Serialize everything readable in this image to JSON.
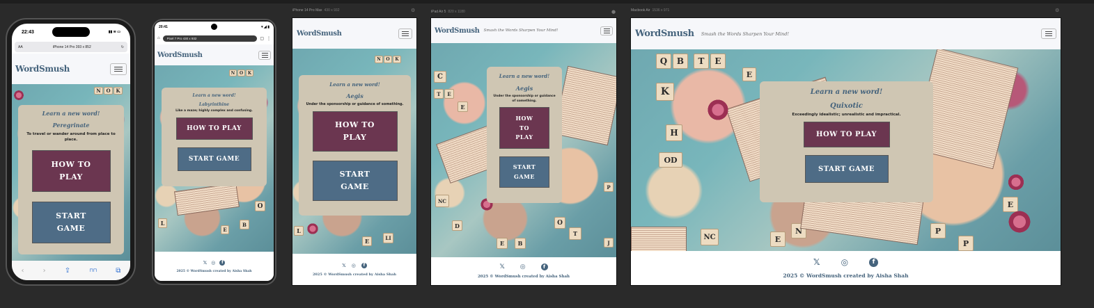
{
  "site": {
    "logo": "WordSmush",
    "tagline": "Smash the Words Sharpen Your Mind!",
    "learn_heading": "Learn a new word!",
    "how_to_play": "HOW TO PLAY",
    "start_game": "START GAME",
    "copyright": "2025 © WordSmush created by Aisha Shah",
    "social_icons": [
      "x-icon",
      "instagram-icon",
      "facebook-icon"
    ]
  },
  "frames": {
    "iphone14pro": {
      "time": "22:43",
      "status_icons": "▮▮ ≋ ▭",
      "url_aa": "AA",
      "url_label": "iPhone 14 Pro  393 x 852",
      "reload": "↻",
      "word": "Peregrinate",
      "definition": "To travel or wander around from place to place."
    },
    "pixel7pro": {
      "time": "20:41",
      "status_icons": "▾ ◢ ▮",
      "url_label": "Pixel 7 Pro  430 x 932",
      "word": "Labyrinthine",
      "definition": "Like a maze; highly complex and confusing."
    },
    "iphone14promax": {
      "label": "iPhone 14 Pro Max",
      "dims": "430 x 932",
      "word": "Aegis",
      "definition": "Under the sponsorship or guidance of something."
    },
    "ipadair": {
      "label": "iPad Air 5",
      "dims": "820 x 1180",
      "word": "Aegis",
      "definition": "Under the sponsorship or guidance of something."
    },
    "macbookair": {
      "label": "Macbook Air",
      "dims": "1536 x 971",
      "word": "Quixotic",
      "definition": "Exceedingly idealistic; unrealistic and impractical."
    }
  },
  "browser_nav": [
    "‹",
    "›",
    "⇪",
    "⊓⊓",
    "⧉"
  ],
  "colors": {
    "brand_blue": "#45637c",
    "play_button": "#6b3650",
    "start_button": "#4e6c86",
    "card": "#cfc6b3",
    "navbar": "#f6f7fa"
  }
}
